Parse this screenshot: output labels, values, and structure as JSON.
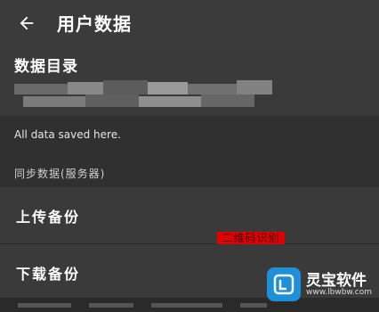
{
  "header": {
    "back_icon": "arrow-left-icon",
    "title": "用户数据"
  },
  "directory": {
    "title": "数据目录",
    "path_obscured": true
  },
  "note": "All data saved here.",
  "sync": {
    "label": "同步数据(服务器)",
    "upload_label": "上传备份",
    "download_label": "下载备份"
  },
  "overlay_text": "二维码识别",
  "watermark": {
    "name": "灵宝软件",
    "url": "www.lbwbw.com",
    "logo_icon": "lb-logo-icon"
  },
  "colors": {
    "background": "#2f2f2f",
    "surface": "#3a3a3a",
    "accent_red": "#e00000",
    "watermark_blue": "#1e90d8"
  }
}
